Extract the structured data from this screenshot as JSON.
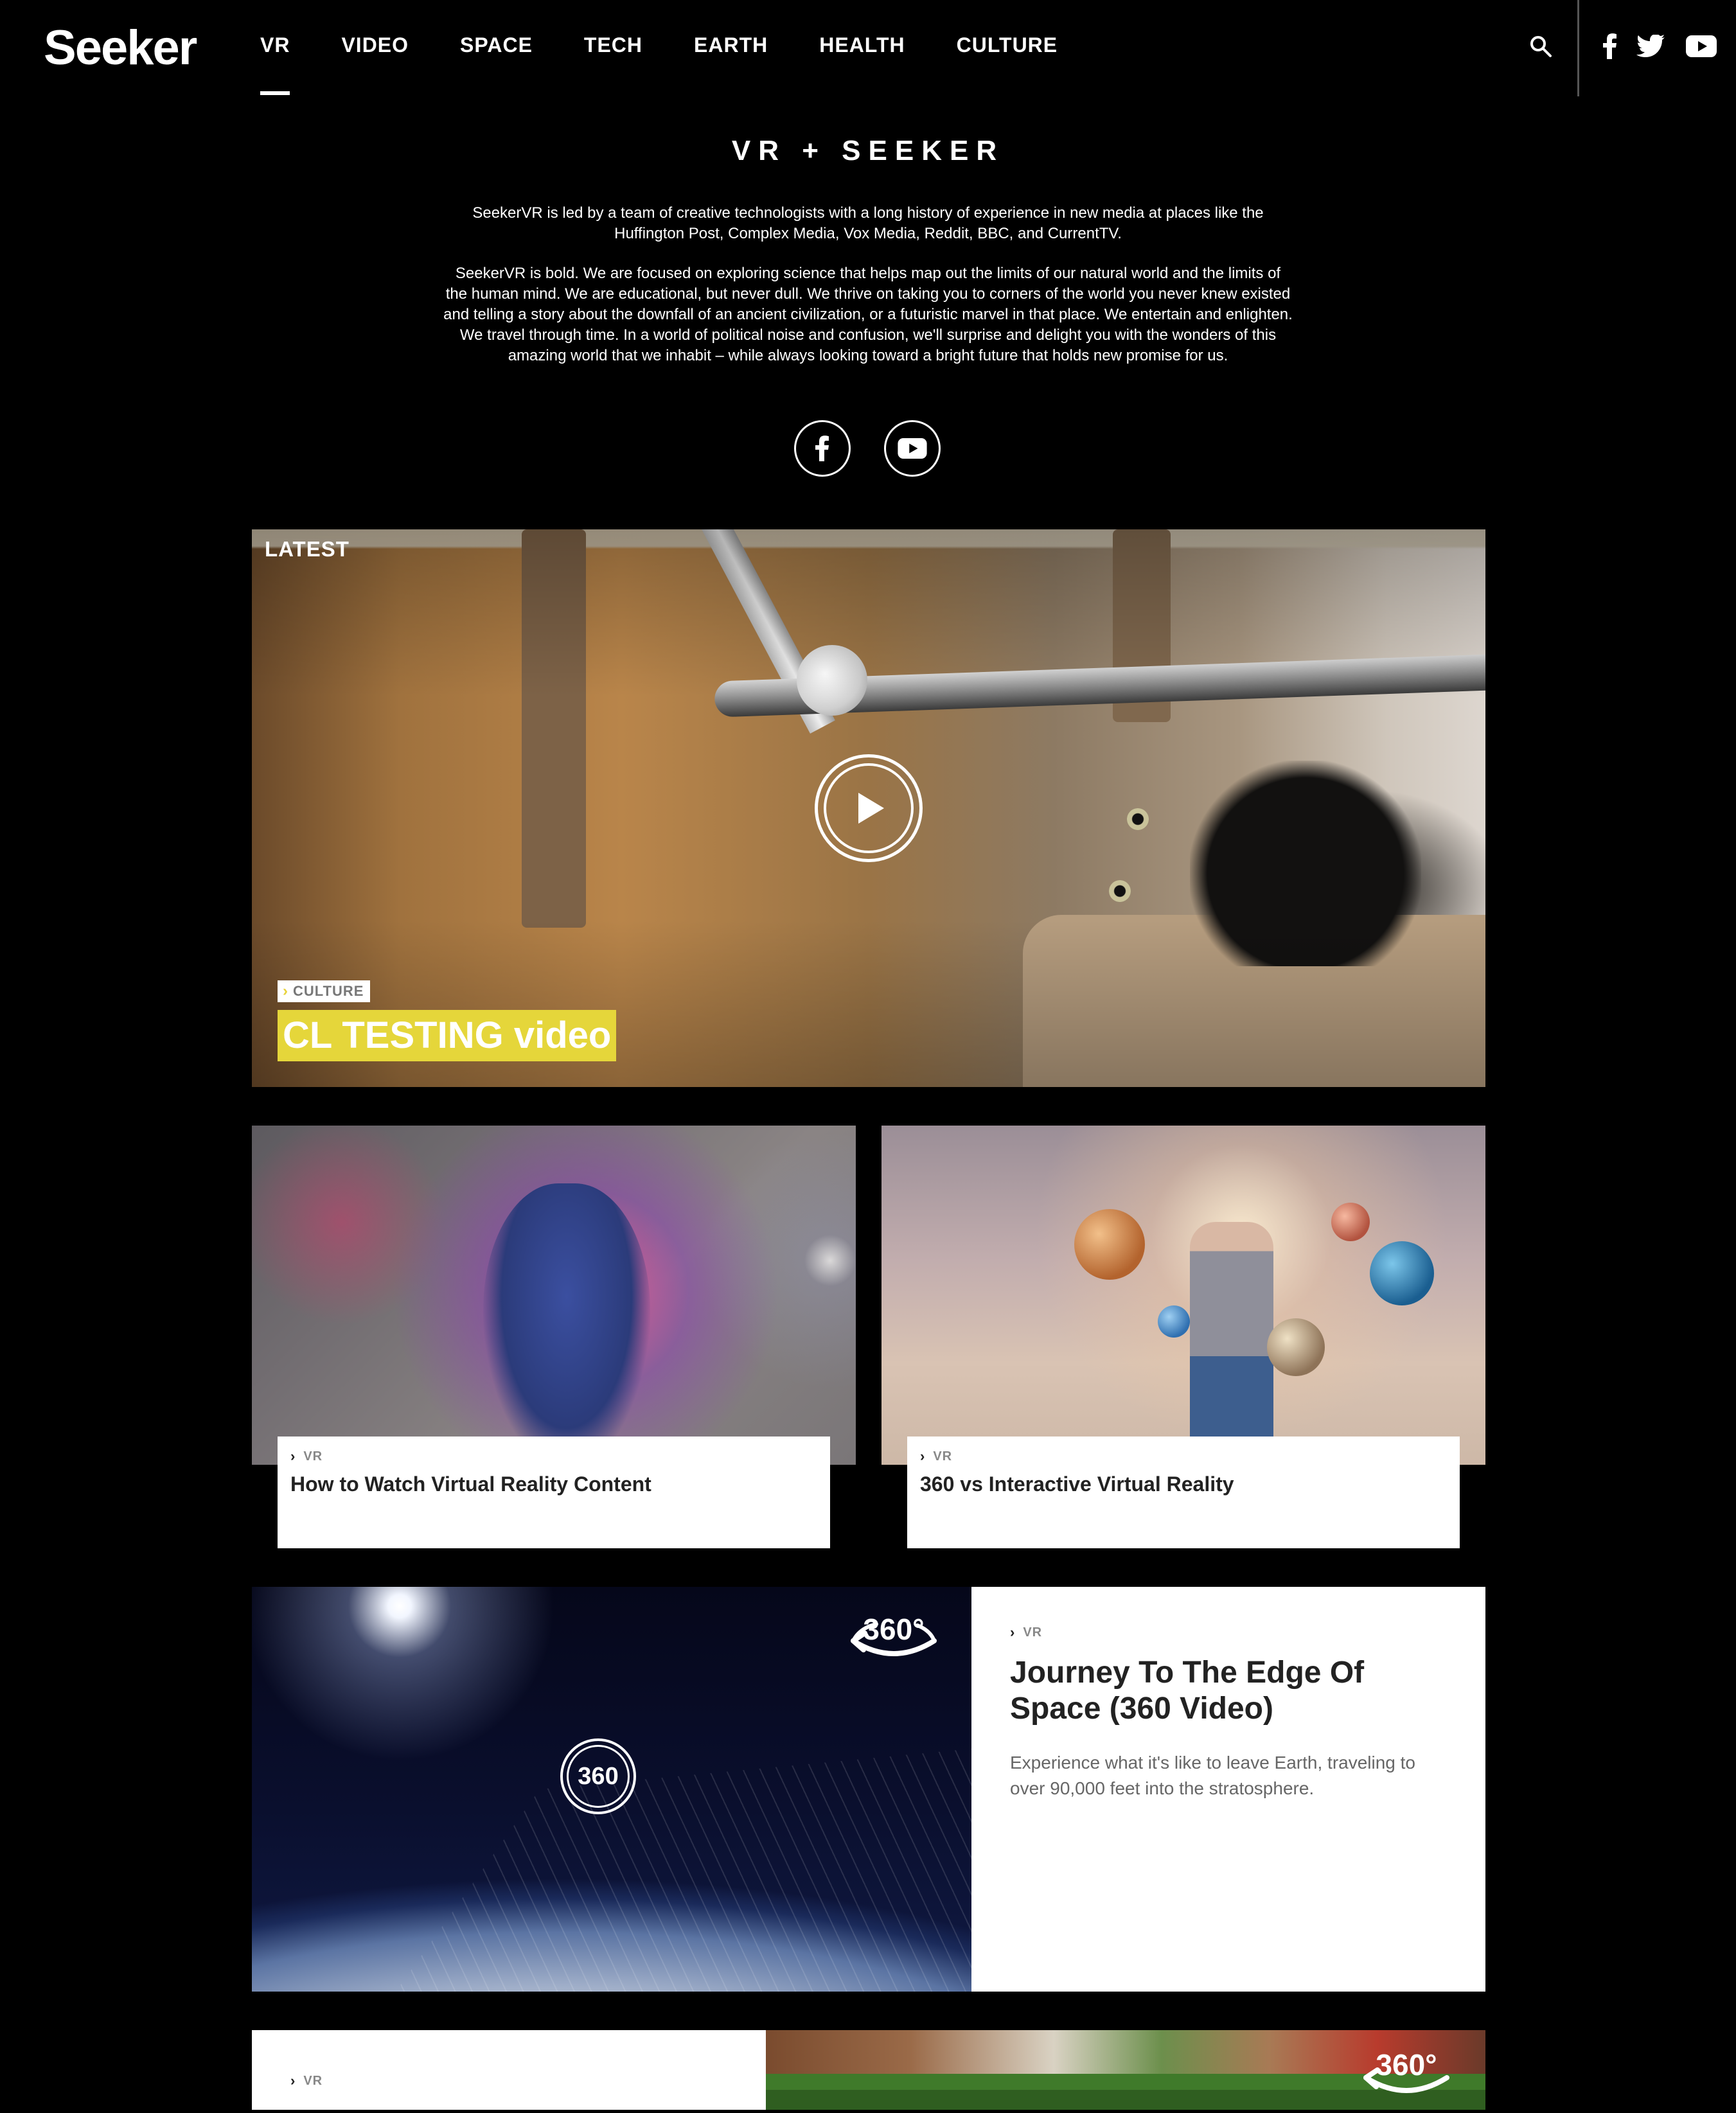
{
  "header": {
    "logo": "Seeker",
    "nav": [
      "VR",
      "VIDEO",
      "SPACE",
      "TECH",
      "EARTH",
      "HEALTH",
      "CULTURE"
    ],
    "active_nav": "VR"
  },
  "intro": {
    "title": "VR + SEEKER",
    "paragraph_1": "SeekerVR is led by a team of creative technologists with a long history of experience in new media at places like the Huffington Post, Complex Media, Vox Media, Reddit, BBC, and CurrentTV.",
    "paragraph_2": "SeekerVR is bold. We are focused on exploring science that helps map out the limits of our natural world and the limits of the human mind. We are educational, but never dull. We thrive on taking you to corners of the world you never knew existed and telling a story about the downfall of an ancient civilization, or a futuristic marvel in that place. We entertain and enlighten. We travel through time. In a world of political noise and confusion, we'll surprise and delight you with the wonders of this amazing world that we inhabit – while always looking toward a bright future that holds new promise for us."
  },
  "hero": {
    "label": "LATEST",
    "tag": "CULTURE",
    "title": "CL TESTING video"
  },
  "cards": [
    {
      "tag": "VR",
      "title": "How to Watch Virtual Reality Content"
    },
    {
      "tag": "VR",
      "title": "360 vs Interactive Virtual Reality"
    }
  ],
  "feature": {
    "badge": "360°",
    "badge_small": "360",
    "tag": "VR",
    "title": "Journey To The Edge Of Space (360 Video)",
    "description": "Experience what it's like to leave Earth, traveling to over 90,000 feet into the stratosphere."
  },
  "next": {
    "tag": "VR",
    "badge": "360°"
  },
  "colors": {
    "background": "#000000",
    "hero_title_bg": "#e5d63a",
    "tag_chevron": "#e8d33c"
  },
  "icons": [
    "search-icon",
    "facebook-icon",
    "twitter-icon",
    "youtube-icon",
    "play-icon",
    "360-icon",
    "chevron-right-icon"
  ]
}
